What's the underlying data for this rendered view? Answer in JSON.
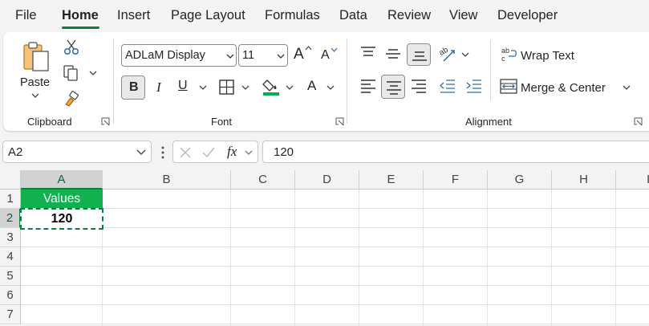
{
  "menu": {
    "tabs": [
      {
        "label": "File"
      },
      {
        "label": "Home"
      },
      {
        "label": "Insert"
      },
      {
        "label": "Page Layout"
      },
      {
        "label": "Formulas"
      },
      {
        "label": "Data"
      },
      {
        "label": "Review"
      },
      {
        "label": "View"
      },
      {
        "label": "Developer"
      }
    ],
    "active_tab": "Home"
  },
  "ribbon": {
    "clipboard": {
      "group_label": "Clipboard",
      "paste_label": "Paste"
    },
    "font": {
      "group_label": "Font",
      "font_name": "ADLaM Display",
      "font_size": "11",
      "bold_label": "B",
      "italic_label": "I",
      "underline_label": "U",
      "grow_label": "A",
      "shrink_label": "A",
      "font_color_label": "A"
    },
    "alignment": {
      "group_label": "Alignment",
      "wrap_text_label": "Wrap Text",
      "merge_center_label": "Merge & Center"
    }
  },
  "formula_bar": {
    "name_box": "A2",
    "formula_value": "120",
    "fx_label": "fx"
  },
  "sheet": {
    "columns": [
      "A",
      "B",
      "C",
      "D",
      "E",
      "F",
      "G",
      "H",
      "I"
    ],
    "rows": [
      "1",
      "2",
      "3",
      "4",
      "5",
      "6",
      "7"
    ],
    "selected_column": "A",
    "selected_row": "2",
    "cells": {
      "A1": "Values",
      "A2": "120"
    }
  },
  "colors": {
    "accent": "#107c41",
    "header_fill": "#13b050",
    "header_text": "#ffffff",
    "font_color_bar": "#00b050"
  }
}
